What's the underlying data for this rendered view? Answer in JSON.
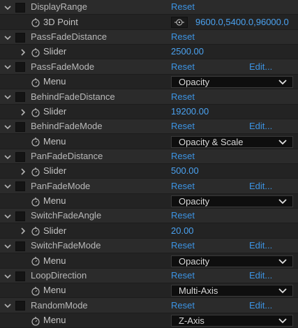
{
  "rows": [
    {
      "kind": "prop",
      "name": "DisplayRange",
      "reset": "Reset"
    },
    {
      "kind": "sub",
      "name": "3D Point",
      "type": "point",
      "value": "9600.0,5400.0,96000.0"
    },
    {
      "kind": "prop",
      "name": "PassFadeDistance",
      "reset": "Reset"
    },
    {
      "kind": "sub",
      "name": "Slider",
      "type": "slider",
      "value": "2500.00"
    },
    {
      "kind": "prop",
      "name": "PassFadeMode",
      "reset": "Reset",
      "edit": "Edit..."
    },
    {
      "kind": "sub",
      "name": "Menu",
      "type": "menu",
      "value": "Opacity"
    },
    {
      "kind": "prop",
      "name": "BehindFadeDistance",
      "reset": "Reset"
    },
    {
      "kind": "sub",
      "name": "Slider",
      "type": "slider",
      "value": "19200.00"
    },
    {
      "kind": "prop",
      "name": "BehindFadeMode",
      "reset": "Reset",
      "edit": "Edit..."
    },
    {
      "kind": "sub",
      "name": "Menu",
      "type": "menu",
      "value": "Opacity & Scale"
    },
    {
      "kind": "prop",
      "name": "PanFadeDistance",
      "reset": "Reset"
    },
    {
      "kind": "sub",
      "name": "Slider",
      "type": "slider",
      "value": "500.00"
    },
    {
      "kind": "prop",
      "name": "PanFadeMode",
      "reset": "Reset",
      "edit": "Edit..."
    },
    {
      "kind": "sub",
      "name": "Menu",
      "type": "menu",
      "value": "Opacity"
    },
    {
      "kind": "prop",
      "name": "SwitchFadeAngle",
      "reset": "Reset"
    },
    {
      "kind": "sub",
      "name": "Slider",
      "type": "slider",
      "value": "20.00"
    },
    {
      "kind": "prop",
      "name": "SwitchFadeMode",
      "reset": "Reset",
      "edit": "Edit..."
    },
    {
      "kind": "sub",
      "name": "Menu",
      "type": "menu",
      "value": "Opacity"
    },
    {
      "kind": "prop",
      "name": "LoopDirection",
      "reset": "Reset",
      "edit": "Edit..."
    },
    {
      "kind": "sub",
      "name": "Menu",
      "type": "menu",
      "value": "Multi-Axis"
    },
    {
      "kind": "prop",
      "name": "RandomMode",
      "reset": "Reset",
      "edit": "Edit..."
    },
    {
      "kind": "sub",
      "name": "Menu",
      "type": "menu",
      "value": "Z-Axis"
    }
  ],
  "colors": {
    "accent": "#3c94e4",
    "value": "#4ba2f0",
    "background": "#232323"
  },
  "icons": {
    "twirl_open": "chevron-down-icon",
    "twirl_closed": "chevron-right-icon",
    "stopwatch": "stopwatch-icon",
    "target": "crosshair-icon",
    "dropdown": "chevron-down-icon"
  }
}
